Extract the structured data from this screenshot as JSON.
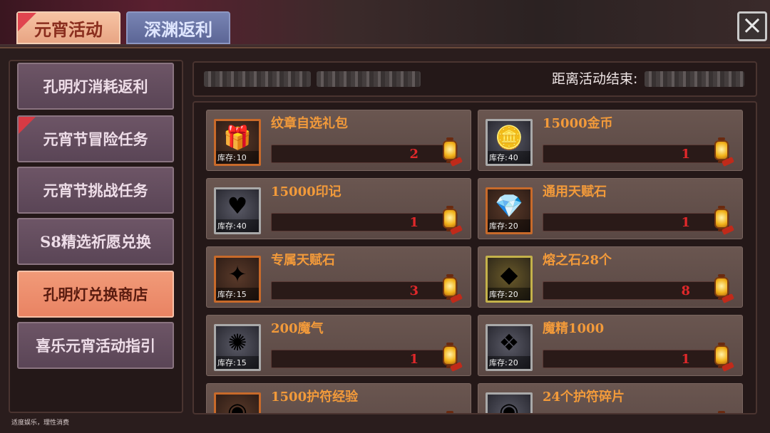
{
  "tabs": [
    {
      "label": "元宵活动",
      "active": true
    },
    {
      "label": "深渊返利",
      "active": false
    }
  ],
  "close_icon": "×",
  "menu": {
    "items": [
      {
        "label": "孔明灯消耗返利",
        "active": false,
        "flag": false
      },
      {
        "label": "元宵节冒险任务",
        "active": false,
        "flag": true
      },
      {
        "label": "元宵节挑战任务",
        "active": false,
        "flag": false
      },
      {
        "label": "S8精选祈愿兑换",
        "active": false,
        "flag": false
      },
      {
        "label": "孔明灯兑换商店",
        "active": true,
        "flag": false
      },
      {
        "label": "喜乐元宵活动指引",
        "active": false,
        "flag": false
      }
    ]
  },
  "footer_note": "适度娱乐，理性消费",
  "info_bar": {
    "timer_label": "距离活动结束:"
  },
  "stock_label": "库存:",
  "shop_items": [
    {
      "name": "纹章自选礼包",
      "stock": "10",
      "cost": "2",
      "icon": "gift-box-icon",
      "glyph": "🎁",
      "frame": "orange"
    },
    {
      "name": "15000金币",
      "stock": "40",
      "cost": "1",
      "icon": "gold-coin-icon",
      "glyph": "🪙",
      "frame": "grey"
    },
    {
      "name": "15000印记",
      "stock": "40",
      "cost": "1",
      "icon": "emblem-shield-icon",
      "glyph": "♥",
      "frame": "grey"
    },
    {
      "name": "通用天赋石",
      "stock": "20",
      "cost": "1",
      "icon": "blue-crystal-icon",
      "glyph": "💎",
      "frame": "orange"
    },
    {
      "name": "专属天赋石",
      "stock": "15",
      "cost": "3",
      "icon": "yellow-crystal-icon",
      "glyph": "✦",
      "frame": "orange"
    },
    {
      "name": "熔之石28个",
      "stock": "20",
      "cost": "8",
      "icon": "red-crystal-icon",
      "glyph": "◆",
      "frame": "yellow"
    },
    {
      "name": "200魔气",
      "stock": "15",
      "cost": "1",
      "icon": "purple-orb-icon",
      "glyph": "✺",
      "frame": "grey"
    },
    {
      "name": "魔精1000",
      "stock": "20",
      "cost": "1",
      "icon": "purple-gem-icon",
      "glyph": "❖",
      "frame": "grey"
    },
    {
      "name": "1500护符经验",
      "stock": "",
      "cost": "",
      "icon": "amulet-orb-icon",
      "glyph": "◉",
      "frame": "orange"
    },
    {
      "name": "24个护符碎片",
      "stock": "",
      "cost": "",
      "icon": "amulet-shard-icon",
      "glyph": "◉",
      "frame": "grey"
    }
  ],
  "colors": {
    "item_name": "#f29a3a",
    "cost": "#e0282a",
    "active_tab": "#f6c3a3",
    "active_menu": "#f19a78"
  }
}
